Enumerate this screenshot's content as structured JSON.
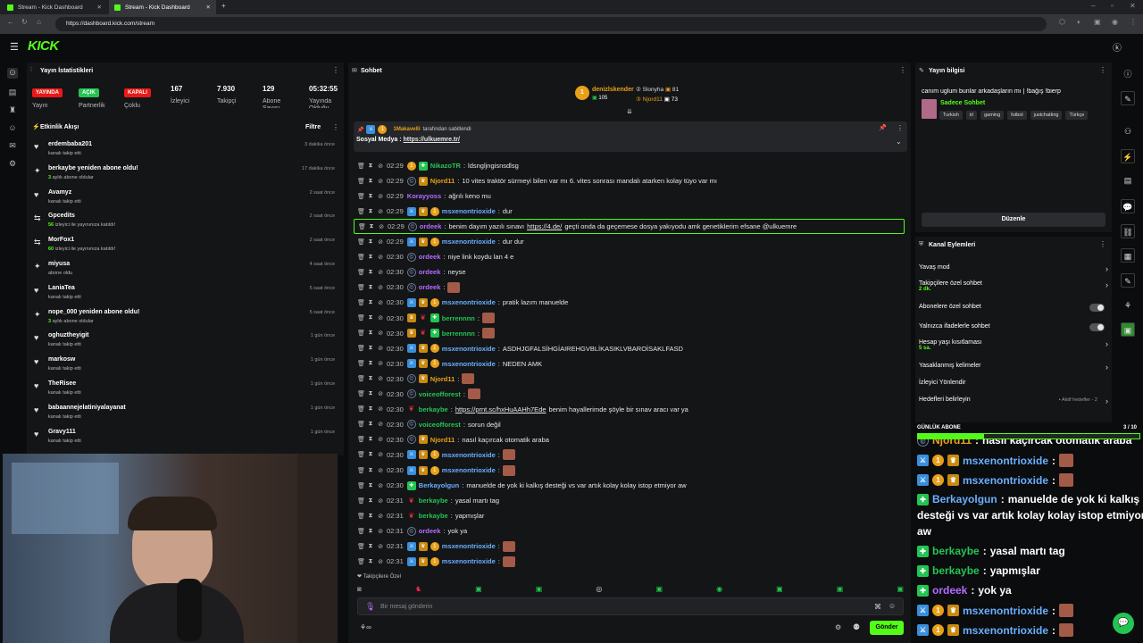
{
  "browser": {
    "tabs": [
      {
        "title": "Stream - Kick Dashboard"
      },
      {
        "title": "Stream - Kick Dashboard"
      }
    ],
    "url": "https://dashboard.kick.com/stream"
  },
  "brand": {
    "logo": "KICK",
    "accent": "#53fc18"
  },
  "stats_panel": {
    "title": "Yayın İstatistikleri",
    "items": [
      {
        "badge": "YAYINDA",
        "label": "Yayın",
        "color": "#e91916"
      },
      {
        "badge": "AÇIK",
        "label": "Partnerlik",
        "color": "#23c552"
      },
      {
        "badge": "KAPALI",
        "label": "Çoklu",
        "color": "#e91916"
      },
      {
        "value": "167",
        "label": "İzleyici"
      },
      {
        "value": "7.930",
        "label": "Takipçi"
      },
      {
        "value": "129",
        "label": "Abone Sayısı"
      },
      {
        "value": "05:32:55",
        "label": "Yayında Olduğu"
      }
    ]
  },
  "activity": {
    "title": "Etkinlik Akışı",
    "filter": "Filtre",
    "items": [
      {
        "name": "erdembaba201",
        "sub": "kanalı takip etti",
        "time": "3 dakika önce",
        "icon": "heart"
      },
      {
        "name": "berkaybe yeniden abone oldu!",
        "sub_num": "3",
        "sub": "aylık abone oldular",
        "time": "17 dakika önce",
        "icon": "star"
      },
      {
        "name": "Avamyz",
        "sub": "kanalı takip etti",
        "time": "2 saat önce",
        "icon": "heart"
      },
      {
        "name": "Gpcedits",
        "sub_num": "56",
        "sub": "izleyici ile yayınınıza katıldı!",
        "time": "2 saat önce",
        "icon": "host"
      },
      {
        "name": "MorFox1",
        "sub_num": "60",
        "sub": "izleyici ile yayınınıza katıldı!",
        "time": "2 saat önce",
        "icon": "host"
      },
      {
        "name": "miyusa",
        "sub": "abone oldu",
        "time": "4 saat önce",
        "icon": "star"
      },
      {
        "name": "LaniaTea",
        "sub": "kanalı takip etti",
        "time": "5 saat önce",
        "icon": "heart"
      },
      {
        "name": "nope_000 yeniden abone oldu!",
        "sub_num": "3",
        "sub": "aylık abone oldular",
        "time": "5 saat önce",
        "icon": "star"
      },
      {
        "name": "oghuztheyigit",
        "sub": "kanalı takip etti",
        "time": "1 gün önce",
        "icon": "heart"
      },
      {
        "name": "markosw",
        "sub": "kanalı takip etti",
        "time": "1 gün önce",
        "icon": "heart"
      },
      {
        "name": "TheRisee",
        "sub": "kanalı takip etti",
        "time": "1 gün önce",
        "icon": "heart"
      },
      {
        "name": "babaannejelatiniyalayanat",
        "sub": "kanalı takip etti",
        "time": "1 gün önce",
        "icon": "heart"
      },
      {
        "name": "Gravy111",
        "sub": "kanalı takip etti",
        "time": "1 gün önce",
        "icon": "heart"
      }
    ]
  },
  "chat": {
    "title": "Sohbet",
    "leaders": {
      "first": {
        "name": "denizlskender",
        "amount": "105"
      },
      "second": {
        "name": "Slonyha",
        "amount": "81"
      },
      "third": {
        "name": "Njord11",
        "amount": "73"
      }
    },
    "pinned": {
      "by": "1Makavelli",
      "by_suffix": "tarafından sabitlendi",
      "text": "Sosyal Medya :",
      "link": "https://ulkuemre.tr/"
    },
    "messages": [
      {
        "time": "02:29",
        "badges": [
          "gold",
          "green"
        ],
        "user": "NikazoTR",
        "color": "#23c552",
        "text": "ldsngljngisnsdlsg"
      },
      {
        "time": "02:29",
        "badges": [
          "og",
          "crown"
        ],
        "user": "Njord11",
        "color": "#e8a019",
        "text": "10 vites traktör sürmeyi bilen var mı 6. vites sonrası mandalı atarken kolay tüyo var mı"
      },
      {
        "time": "02:29",
        "badges": [],
        "user": "Korayyoss",
        "color": "#b46cff",
        "text": "ağrılı keno mu"
      },
      {
        "time": "02:29",
        "badges": [
          "blue",
          "crown",
          "gold"
        ],
        "user": "msxenontrioxide",
        "color": "#6ab0ff",
        "text": "dur"
      },
      {
        "time": "02:29",
        "badges": [
          "og"
        ],
        "user": "ordeek",
        "color": "#b46cff",
        "text": "benim dayım yazılı sınavı",
        "link": "https://4.de/",
        "text2": "geçti onda da geçemese dosya yakıyodu amk genetiklerim efsane @ulkuemre",
        "highlight": true
      },
      {
        "time": "02:29",
        "badges": [
          "blue",
          "crown",
          "gold"
        ],
        "user": "msxenontrioxide",
        "color": "#6ab0ff",
        "text": "dur dur"
      },
      {
        "time": "02:30",
        "badges": [
          "og"
        ],
        "user": "ordeek",
        "color": "#b46cff",
        "text": "niye link koydu lan 4 e"
      },
      {
        "time": "02:30",
        "badges": [
          "og"
        ],
        "user": "ordeek",
        "color": "#b46cff",
        "text": "neyse"
      },
      {
        "time": "02:30",
        "badges": [
          "og"
        ],
        "user": "ordeek",
        "color": "#b46cff",
        "text": "",
        "emote": true
      },
      {
        "time": "02:30",
        "badges": [
          "blue",
          "crown",
          "gold"
        ],
        "user": "msxenontrioxide",
        "color": "#6ab0ff",
        "text": "pratik lazım manuelde"
      },
      {
        "time": "02:30",
        "badges": [
          "crown",
          "red",
          "green"
        ],
        "user": "berrennnn",
        "color": "#23c552",
        "text": "",
        "emote": true
      },
      {
        "time": "02:30",
        "badges": [
          "crown",
          "red",
          "green"
        ],
        "user": "berrennnn",
        "color": "#23c552",
        "text": "",
        "emote": true
      },
      {
        "time": "02:30",
        "badges": [
          "blue",
          "crown",
          "gold"
        ],
        "user": "msxenontrioxide",
        "color": "#6ab0ff",
        "text": "ASDHJGFALSİHGİAIREHGVBLİKASIKLVBAROİSAKLFASD"
      },
      {
        "time": "02:30",
        "badges": [
          "blue",
          "crown",
          "gold"
        ],
        "user": "msxenontrioxide",
        "color": "#6ab0ff",
        "text": "NEDEN AMK"
      },
      {
        "time": "02:30",
        "badges": [
          "og",
          "crown"
        ],
        "user": "Njord11",
        "color": "#e8a019",
        "text": "",
        "emote": true
      },
      {
        "time": "02:30",
        "badges": [
          "og"
        ],
        "user": "voiceofforest",
        "color": "#23c552",
        "text": "",
        "emote": true
      },
      {
        "time": "02:30",
        "badges": [
          "red"
        ],
        "user": "berkaybe",
        "color": "#23c552",
        "text": "",
        "link": "https://prnt.sc/hxHuAAHh7Ede",
        "text2": "benim hayallerimde şöyle bir sınav aracı var ya"
      },
      {
        "time": "02:30",
        "badges": [
          "og"
        ],
        "user": "voiceofforest",
        "color": "#23c552",
        "text": "sorun değil"
      },
      {
        "time": "02:30",
        "badges": [
          "og",
          "crown"
        ],
        "user": "Njord11",
        "color": "#e8a019",
        "text": "nasıl kaçırcak otomatik araba"
      },
      {
        "time": "02:30",
        "badges": [
          "blue",
          "crown",
          "gold"
        ],
        "user": "msxenontrioxide",
        "color": "#6ab0ff",
        "text": "",
        "emote": true
      },
      {
        "time": "02:30",
        "badges": [
          "blue",
          "crown",
          "gold"
        ],
        "user": "msxenontrioxide",
        "color": "#6ab0ff",
        "text": "",
        "emote": true
      },
      {
        "time": "02:30",
        "badges": [
          "green"
        ],
        "user": "Berkayolgun",
        "color": "#6ab0ff",
        "text": "manuelde de yok ki kalkış desteği vs var artık kolay kolay istop etmiyor aw"
      },
      {
        "time": "02:31",
        "badges": [
          "red"
        ],
        "user": "berkaybe",
        "color": "#23c552",
        "text": "yasal martı tag"
      },
      {
        "time": "02:31",
        "badges": [
          "red"
        ],
        "user": "berkaybe",
        "color": "#23c552",
        "text": "yapmışlar"
      },
      {
        "time": "02:31",
        "badges": [
          "og"
        ],
        "user": "ordeek",
        "color": "#b46cff",
        "text": "yok ya"
      },
      {
        "time": "02:31",
        "badges": [
          "blue",
          "crown",
          "gold"
        ],
        "user": "msxenontrioxide",
        "color": "#6ab0ff",
        "text": "",
        "emote": true
      },
      {
        "time": "02:31",
        "badges": [
          "blue",
          "crown",
          "gold"
        ],
        "user": "msxenontrioxide",
        "color": "#6ab0ff",
        "text": "",
        "emote": true
      }
    ],
    "followers_only": "Takipçilere Özel",
    "input_placeholder": "Bir mesaj gönderin",
    "send": "Gönder"
  },
  "stream_info": {
    "title": "Yayın bilgisi",
    "stream_title": "canım uglum bunlar arkadaşların mı | !bağış !bierp",
    "category": "Sadece Sohbet",
    "tags": [
      "Turkish",
      "irl",
      "gaming",
      "futbol",
      "justchatting",
      "Türkçe"
    ],
    "edit": "Düzenle"
  },
  "channel_actions": {
    "title": "Kanal Eylemleri",
    "items": [
      {
        "label": "Yavaş mod",
        "type": "chevron"
      },
      {
        "label": "Takipçilere özel sohbet",
        "sub": "2 dk.",
        "type": "chevron"
      },
      {
        "label": "Abonelere özel sohbet",
        "type": "toggle"
      },
      {
        "label": "Yalnızca ifadelerle sohbet",
        "type": "toggle"
      },
      {
        "label": "Hesap yaşı kısıtlaması",
        "sub": "5 sa.",
        "type": "chevron"
      },
      {
        "label": "Yasaklanmış kelimeler",
        "type": "chevron"
      },
      {
        "label": "İzleyici Yönlendir",
        "type": "none"
      },
      {
        "label": "Hedefleri belirleyin",
        "extra": "Aktif hedefler - 2",
        "type": "chevron"
      }
    ]
  },
  "goal": {
    "label": "GÜNLÜK ABONE",
    "count": "3 / 10",
    "progress": 0.3
  },
  "overlay_chat": [
    {
      "badges": [
        "og"
      ],
      "user": "Njord11",
      "color": "#e8a019",
      "text": "nasıl kaçırcak otomatik araba"
    },
    {
      "badges": [
        "blue",
        "gold",
        "crown"
      ],
      "user": "msxenontrioxide",
      "color": "#6ab0ff",
      "text": "",
      "emote": true
    },
    {
      "badges": [
        "blue",
        "gold",
        "crown"
      ],
      "user": "msxenontrioxide",
      "color": "#6ab0ff",
      "text": "",
      "emote": true
    },
    {
      "badges": [
        "green"
      ],
      "user": "Berkayolgun",
      "color": "#6ab0ff",
      "text": "manuelde de yok ki kalkış",
      "line2": "desteği vs var artık kolay kolay istop etmiyor",
      "line3": "aw"
    },
    {
      "badges": [
        "green"
      ],
      "user": "berkaybe",
      "color": "#23c552",
      "text": "yasal martı tag"
    },
    {
      "badges": [
        "green"
      ],
      "user": "berkaybe",
      "color": "#23c552",
      "text": "yapmışlar"
    },
    {
      "badges": [
        "green"
      ],
      "user": "ordeek",
      "color": "#b46cff",
      "text": "yok ya"
    },
    {
      "badges": [
        "blue",
        "gold",
        "crown"
      ],
      "user": "msxenontrioxide",
      "color": "#6ab0ff",
      "text": "",
      "emote": true
    },
    {
      "badges": [
        "blue",
        "gold",
        "crown"
      ],
      "user": "msxenontrioxide",
      "color": "#6ab0ff",
      "text": "",
      "emote": true
    }
  ]
}
